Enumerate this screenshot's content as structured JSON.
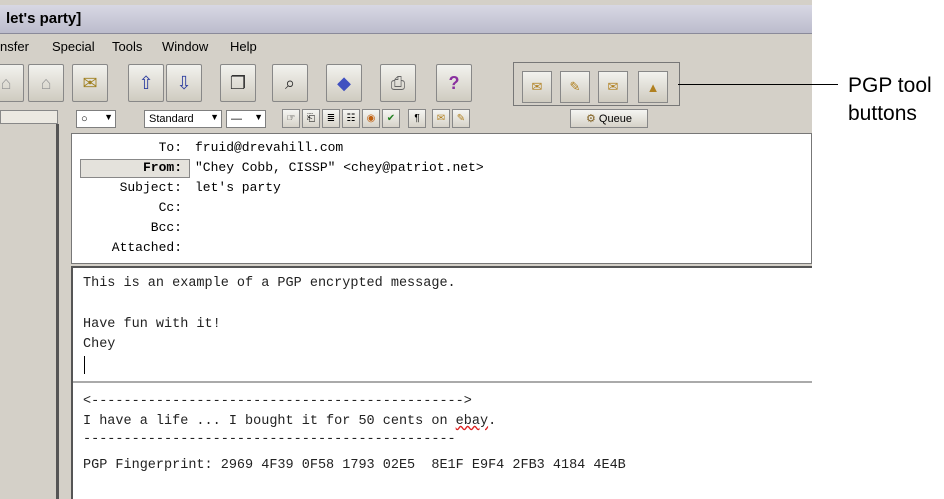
{
  "window": {
    "title": "let's party]"
  },
  "menu": {
    "items": [
      "nsfer",
      "Special",
      "Tools",
      "Window",
      "Help"
    ]
  },
  "toolbar": {
    "buttons": [
      "house-icon",
      "house-icon",
      "mailbox-icon",
      "up-arrow-icon",
      "down-arrow-icon",
      "copy-icon",
      "find-icon",
      "book-icon",
      "paint-icon",
      "printer-icon",
      "help-icon"
    ],
    "pgp_buttons": [
      "pgp-encrypt-icon",
      "pgp-sign-icon",
      "pgp-encrypt-sign-icon",
      "pgp-mime-icon"
    ]
  },
  "format_bar": {
    "priority": "○",
    "font_select": "Standard",
    "size_select": "—",
    "queue_label": "Queue"
  },
  "headers": {
    "to_label": "To:",
    "to_value": "fruid@drevahill.com",
    "from_label": "From:",
    "from_value": "\"Chey Cobb, CISSP\" <chey@patriot.net>",
    "subject_label": "Subject:",
    "subject_value": "let's party",
    "cc_label": "Cc:",
    "bcc_label": "Bcc:",
    "attached_label": "Attached:"
  },
  "body": {
    "line1": "This is an example of a PGP encrypted message.",
    "line2": "Have fun with it!",
    "line3": "Chey",
    "sig_top": "<---------------------------------------------->",
    "sig_text_pre": "I have a life ... I bought it for 50 cents on ",
    "sig_text_link": "ebay",
    "sig_text_post": ".",
    "sig_rule": "----------------------------------------------",
    "fingerprint": "PGP Fingerprint: 2969 4F39 0F58 1793 02E5  8E1F E9F4 2FB3 4184 4E4B"
  },
  "callout": {
    "line1": "PGP tool",
    "line2": "buttons"
  }
}
